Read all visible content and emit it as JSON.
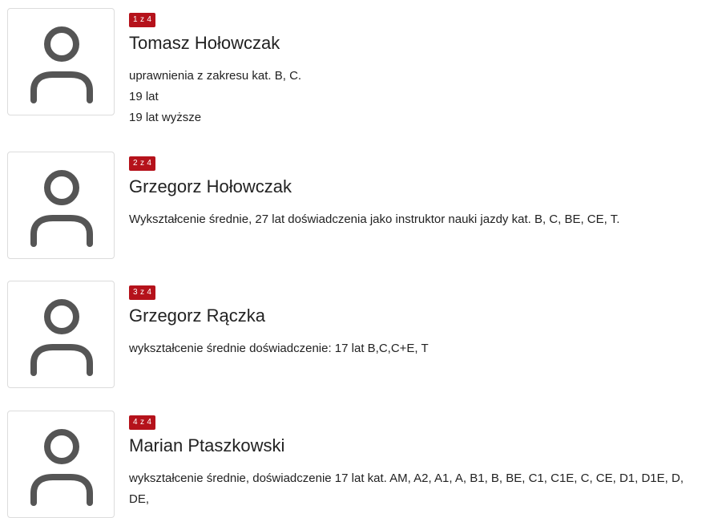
{
  "staff": [
    {
      "counter": "1 z 4",
      "name": "Tomasz Hołowczak",
      "lines": [
        "uprawnienia z zakresu kat. B, C.",
        "19 lat",
        "19 lat wyższe"
      ]
    },
    {
      "counter": "2 z 4",
      "name": "Grzegorz Hołowczak",
      "lines": [
        "Wykształcenie średnie, 27 lat doświadczenia jako instruktor nauki jazdy kat. B, C, BE, CE, T."
      ]
    },
    {
      "counter": "3 z 4",
      "name": "Grzegorz Rączka",
      "lines": [
        "wykształcenie średnie doświadczenie: 17 lat B,C,C+E, T"
      ]
    },
    {
      "counter": "4 z 4",
      "name": "Marian Ptaszkowski",
      "lines": [
        "wykształcenie średnie, doświadczenie 17 lat kat. AM, A2, A1, A, B1, B, BE, C1, C1E, C, CE, D1, D1E, D,",
        "DE,"
      ]
    }
  ],
  "colors": {
    "badge": "#b5121b",
    "avatar_icon": "#555555"
  },
  "icons": {
    "avatar": "user-icon"
  }
}
